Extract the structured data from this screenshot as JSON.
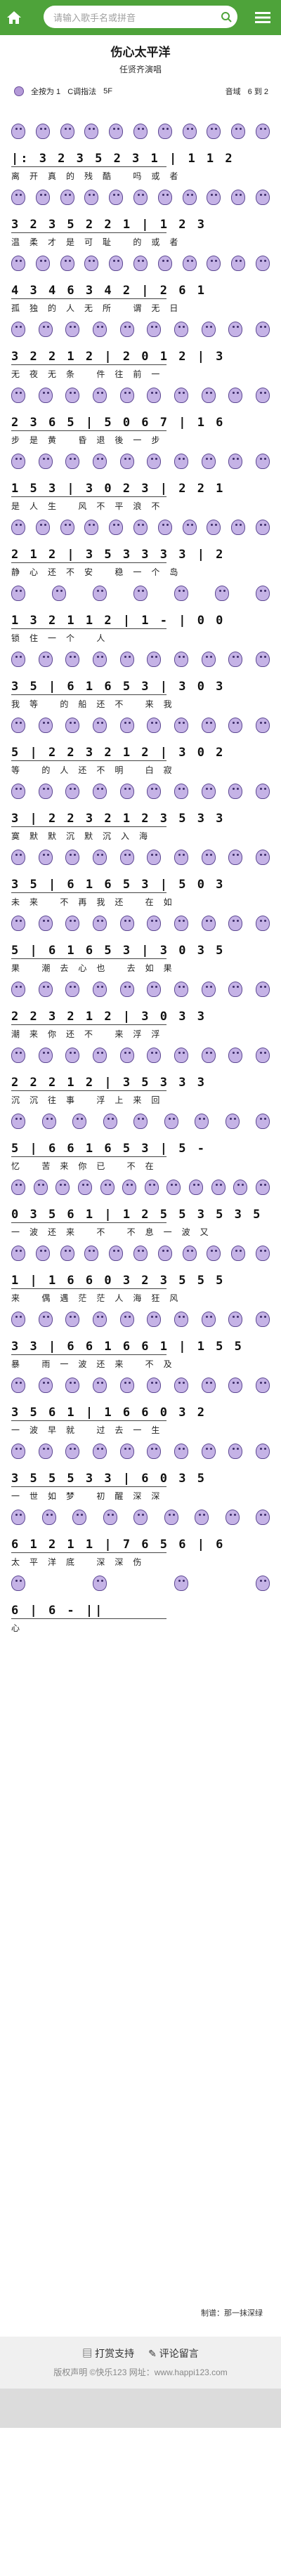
{
  "header": {
    "search_placeholder": "请输入歌手名或拼音",
    "colors": {
      "bar": "#4ea33a",
      "accent": "#b49ad8"
    },
    "icons": [
      "home-icon",
      "search-icon",
      "menu-icon"
    ]
  },
  "song": {
    "title": "伤心太平洋",
    "singer": "任贤齐演唱",
    "meta_left": [
      "全按为 1",
      "C调指法",
      "5F"
    ],
    "meta_right": [
      "音域",
      "6 到 2"
    ]
  },
  "lines": [
    {
      "notes": "|: 3 2 3 5  2 3 1 | 1 1 2",
      "lyrics": "离开真的残酷 吗或者"
    },
    {
      "notes": "3 2 3 5  2 2 1 | 1 2 3",
      "lyrics": "温柔才是可耻 的或者"
    },
    {
      "notes": "4 3 4 6  3 4 2 | 2 6 1",
      "lyrics": "孤独的人无所 谓无日"
    },
    {
      "notes": "3 2 2 1 2 | 2 0 1 2 | 3",
      "lyrics": "无夜无条 件往前一"
    },
    {
      "notes": "2 3 6 5  | 5 0 6 7 | 1 6",
      "lyrics": "步是黄 昏退後一步"
    },
    {
      "notes": "1 5 3  | 3 0 2 3 | 2 2 1",
      "lyrics": "是人生 风不平浪不"
    },
    {
      "notes": "2 1 2  | 3 5 3 3 3 3 | 2",
      "lyrics": "静心还不安 稳一个岛"
    },
    {
      "notes": "1 3 2 1 1 2  | 1 -  | 0 0",
      "lyrics": "锁住一个 人"
    },
    {
      "notes": "3 5  | 6 1 6 5 3 | 3 0 3",
      "lyrics": "我等 的船还不 来我"
    },
    {
      "notes": "5  | 2 2 3 2 1 2 | 3 0 2",
      "lyrics": "等 的人还不明 白寂"
    },
    {
      "notes": "3  | 2 2 3 2 1 2 3 5 3 3",
      "lyrics": "寞默默沉默沉入海"
    },
    {
      "notes": "3 5  | 6 1 6 5 3 | 5 0 3",
      "lyrics": "未来 不再我还 在如"
    },
    {
      "notes": "5  | 6 1 6 5 3 | 3 0 3 5",
      "lyrics": "果 潮去心也 去如果"
    },
    {
      "notes": "2 2 3 2 1 2  | 3 0 3 3",
      "lyrics": "潮来你还不 来浮浮"
    },
    {
      "notes": "2 2 2 1 2  | 3 5 3 3 3",
      "lyrics": "沉沉往事 浮上来回"
    },
    {
      "notes": "5  | 6 6 1 6 5 3 | 5 -",
      "lyrics": "忆 苦来你已 不在"
    },
    {
      "notes": "0 3 5 6 1  | 1 2 5 5 3 5 3 5",
      "lyrics": "一波还来 不 不息一波又"
    },
    {
      "notes": "1  | 1 6 6 0 3 2 3 5 5 5",
      "lyrics": "来 偶遇茫茫人海狂风"
    },
    {
      "notes": "3 3  | 6 6 1 6 6 1 | 1 5 5",
      "lyrics": "暴 雨一波还来 不及"
    },
    {
      "notes": "3 5 6 1  | 1 6 6 0 3 2",
      "lyrics": "一波早就 过去一生"
    },
    {
      "notes": "3 5 5 5 3 3  | 6 0 3 5",
      "lyrics": "一世如梦 初醒深深"
    },
    {
      "notes": "6 1 2 1 1  | 7 6 5 6  | 6",
      "lyrics": "太平洋底 深深伤"
    },
    {
      "notes": "6  | 6 -  ||",
      "lyrics": "心"
    }
  ],
  "author": "制谱：那一抹深绿",
  "footer": {
    "actions": [
      "打赏支持",
      "评论留言"
    ],
    "copyright": "版权声明 ©快乐123 网址：www.happi123.com"
  }
}
